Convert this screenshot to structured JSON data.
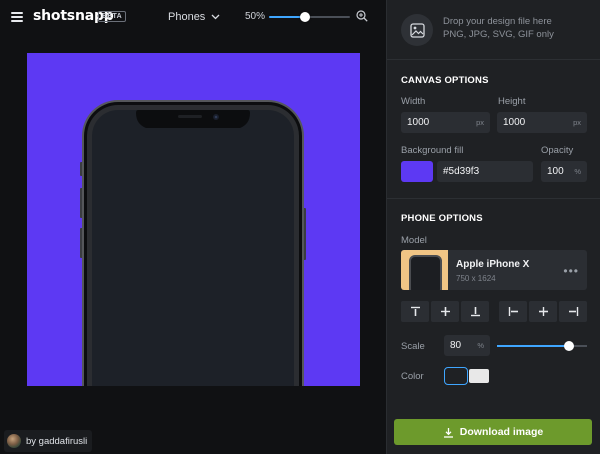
{
  "app": {
    "brand": "shotsnapp",
    "badge": "BETA"
  },
  "toolbar": {
    "device_category": "Phones",
    "zoom_label": "50%",
    "zoom_level": 0.45
  },
  "canvas": {
    "background": "#5d39f3",
    "credit": "by gaddafirusli"
  },
  "upload": {
    "line1": "Drop your design file here",
    "line2": "PNG, JPG, SVG, GIF only"
  },
  "canvas_options": {
    "title": "CANVAS OPTIONS",
    "width_label": "Width",
    "width_value": "1000",
    "height_label": "Height",
    "height_value": "1000",
    "unit_px": "px",
    "bg_label": "Background fill",
    "bg_value": "#5d39f3",
    "opacity_label": "Opacity",
    "opacity_value": "100",
    "unit_pct": "%"
  },
  "phone_options": {
    "title": "PHONE OPTIONS",
    "model_label": "Model",
    "model_name": "Apple iPhone X",
    "model_size": "750 x 1624",
    "scale_label": "Scale",
    "scale_value": "80",
    "scale_unit": "%",
    "scale_level": 0.8,
    "color_label": "Color",
    "colors": [
      "#1f2124",
      "#e8e8e8"
    ]
  },
  "download": {
    "label": "Download image"
  },
  "colors": {
    "accent": "#3fa6ff",
    "download_bg": "#6d9a2c",
    "panel_bg": "#1f2124"
  },
  "icons": [
    "menu-icon",
    "chevron-down-icon",
    "zoom-in-icon",
    "image-icon",
    "more-icon",
    "align-top-icon",
    "align-middle-icon",
    "align-bottom-icon",
    "align-left-icon",
    "align-center-icon",
    "align-right-icon",
    "download-icon"
  ]
}
